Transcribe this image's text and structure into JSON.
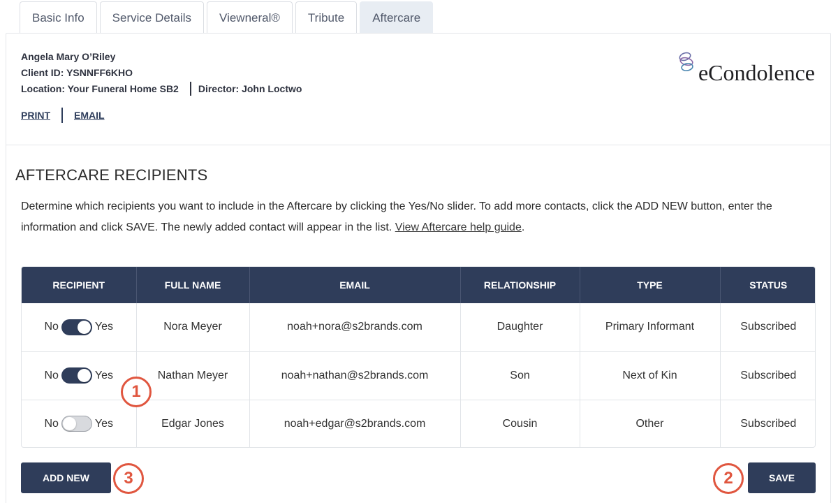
{
  "tabs": [
    {
      "label": "Basic Info",
      "active": false
    },
    {
      "label": "Service Details",
      "active": false
    },
    {
      "label": "Viewneral®",
      "active": false
    },
    {
      "label": "Tribute",
      "active": false
    },
    {
      "label": "Aftercare",
      "active": true
    }
  ],
  "client": {
    "name": "Angela Mary O’Riley",
    "client_id": "Client ID: YSNNFF6KHO",
    "location": "Location: Your Funeral Home SB2",
    "director": "Director: John Loctwo"
  },
  "links": {
    "print": "PRINT",
    "email": "EMAIL"
  },
  "logo": {
    "text": "eCondolence",
    "icon": "swirl-logo-icon"
  },
  "section": {
    "title": "AFTERCARE RECIPIENTS",
    "description": "Determine which recipients you want to include in the Aftercare by clicking the Yes/No slider. To add more contacts, click the ADD NEW button, enter the information and click SAVE. The newly added contact will appear in the list. ",
    "help_link": "View Aftercare help guide",
    "help_suffix": "."
  },
  "table": {
    "headers": [
      "RECIPIENT",
      "FULL NAME",
      "EMAIL",
      "RELATIONSHIP",
      "TYPE",
      "STATUS"
    ],
    "toggle_no": "No",
    "toggle_yes": "Yes",
    "rows": [
      {
        "included": true,
        "full_name": "Nora Meyer",
        "email": "noah+nora@s2brands.com",
        "relationship": "Daughter",
        "type": "Primary Informant",
        "status": "Subscribed"
      },
      {
        "included": true,
        "full_name": "Nathan Meyer",
        "email": "noah+nathan@s2brands.com",
        "relationship": "Son",
        "type": "Next of Kin",
        "status": "Subscribed"
      },
      {
        "included": false,
        "full_name": "Edgar Jones",
        "email": "noah+edgar@s2brands.com",
        "relationship": "Cousin",
        "type": "Other",
        "status": "Subscribed"
      }
    ]
  },
  "buttons": {
    "add_new": "ADD NEW",
    "save": "SAVE"
  },
  "callouts": [
    "1",
    "2",
    "3"
  ],
  "colors": {
    "primary": "#2f3d5a",
    "callout": "#e0563f",
    "tab_active": "#e8edf3"
  }
}
